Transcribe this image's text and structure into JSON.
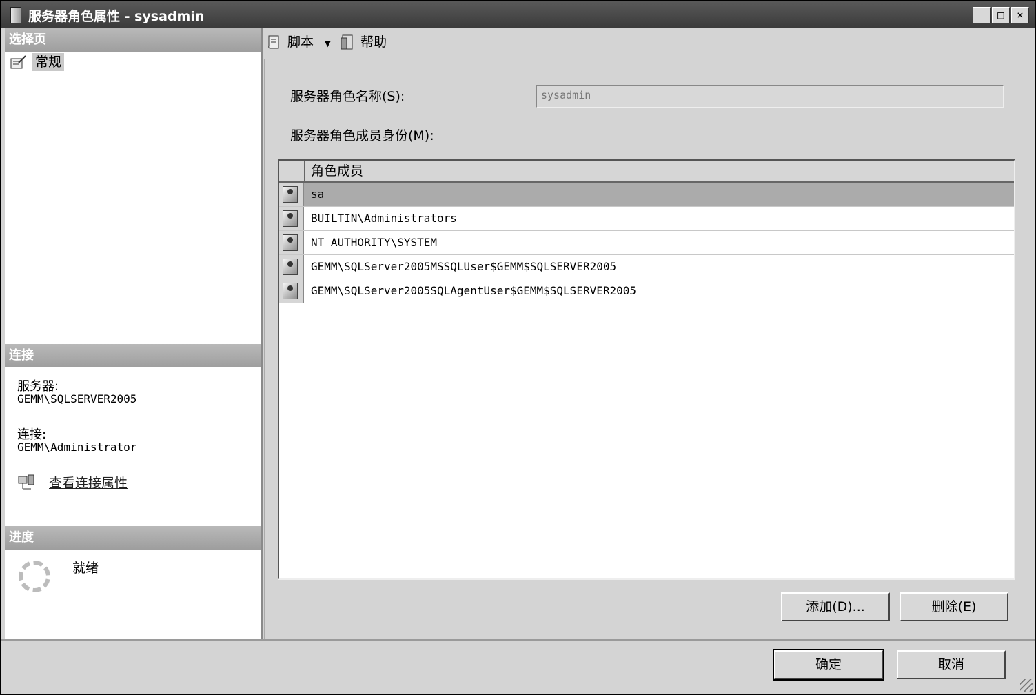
{
  "window": {
    "title": "服务器角色属性 - sysadmin",
    "minimize": "_",
    "maximize": "□",
    "close": "×"
  },
  "left_panel": {
    "select_page_header": "选择页",
    "pages": [
      {
        "label": "常规"
      }
    ],
    "connection_header": "连接",
    "server_label": "服务器:",
    "server_value": "GEMM\\SQLSERVER2005",
    "connection_label": "连接:",
    "connection_value": "GEMM\\Administrator",
    "view_connection_link": "查看连接属性",
    "progress_header": "进度",
    "progress_status": "就绪"
  },
  "toolbar": {
    "script_label": "脚本",
    "help_label": "帮助"
  },
  "form": {
    "role_name_label": "服务器角色名称(S):",
    "role_name_value": "sysadmin",
    "membership_label": "服务器角色成员身份(M):",
    "members_column_header": "角色成员",
    "members": [
      {
        "name": "sa"
      },
      {
        "name": "BUILTIN\\Administrators"
      },
      {
        "name": "NT AUTHORITY\\SYSTEM"
      },
      {
        "name": "GEMM\\SQLServer2005MSSQLUser$GEMM$SQLSERVER2005"
      },
      {
        "name": "GEMM\\SQLServer2005SQLAgentUser$GEMM$SQLSERVER2005"
      }
    ],
    "selected_member_index": 0,
    "add_button": "添加(D)...",
    "remove_button": "删除(E)"
  },
  "footer": {
    "ok_button": "确定",
    "cancel_button": "取消"
  }
}
